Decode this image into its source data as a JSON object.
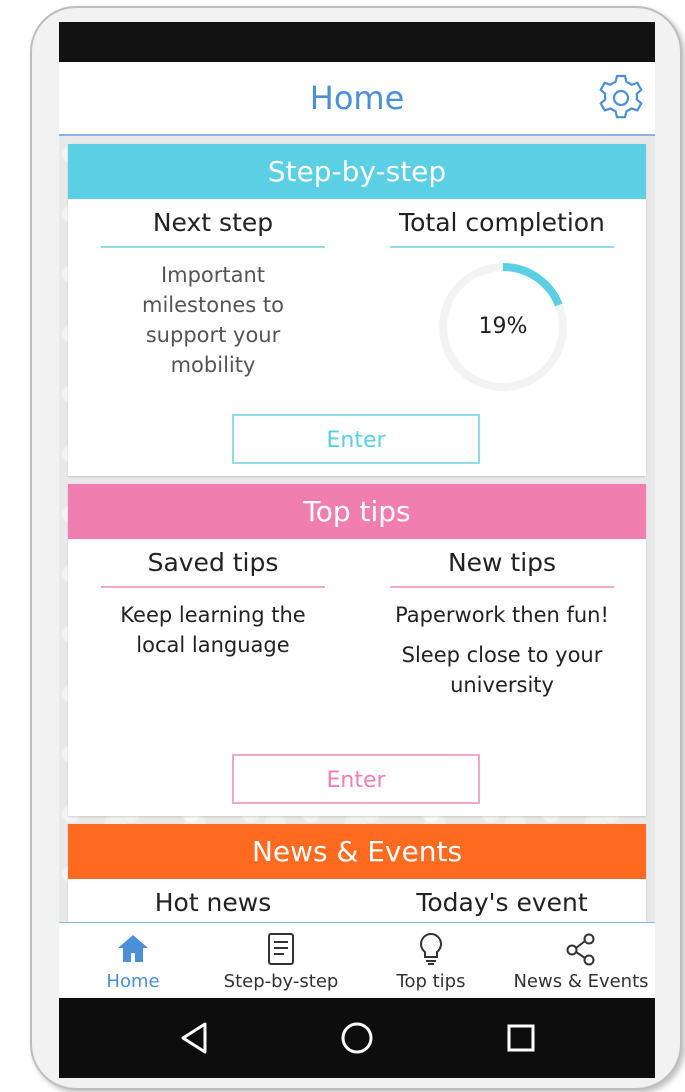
{
  "header": {
    "title": "Home"
  },
  "cards": {
    "step": {
      "title": "Step-by-step",
      "color": "#5bcfe4",
      "left": {
        "title": "Next step",
        "text": "Important milestones to support your mobility"
      },
      "right": {
        "title": "Total completion",
        "progress_label": "19%",
        "progress": 0.19
      },
      "button": "Enter"
    },
    "tips": {
      "title": "Top tips",
      "color": "#f07fb0",
      "left": {
        "title": "Saved tips",
        "text": "Keep learning the local language"
      },
      "right": {
        "title": "New tips",
        "text1": "Paperwork then fun!",
        "text2": "Sleep close to your university"
      },
      "button": "Enter"
    },
    "news": {
      "title": "News & Events",
      "color": "#ff6a21",
      "left": {
        "title": "Hot news"
      },
      "right": {
        "title": "Today's event"
      }
    }
  },
  "bottom_nav": {
    "home": "Home",
    "step": "Step-by-step",
    "tips": "Top tips",
    "news": "News & Events"
  },
  "colors": {
    "accent": "#4a90d9",
    "step": "#5bcfe4",
    "tips": "#f07fb0",
    "news": "#ff6a21"
  }
}
